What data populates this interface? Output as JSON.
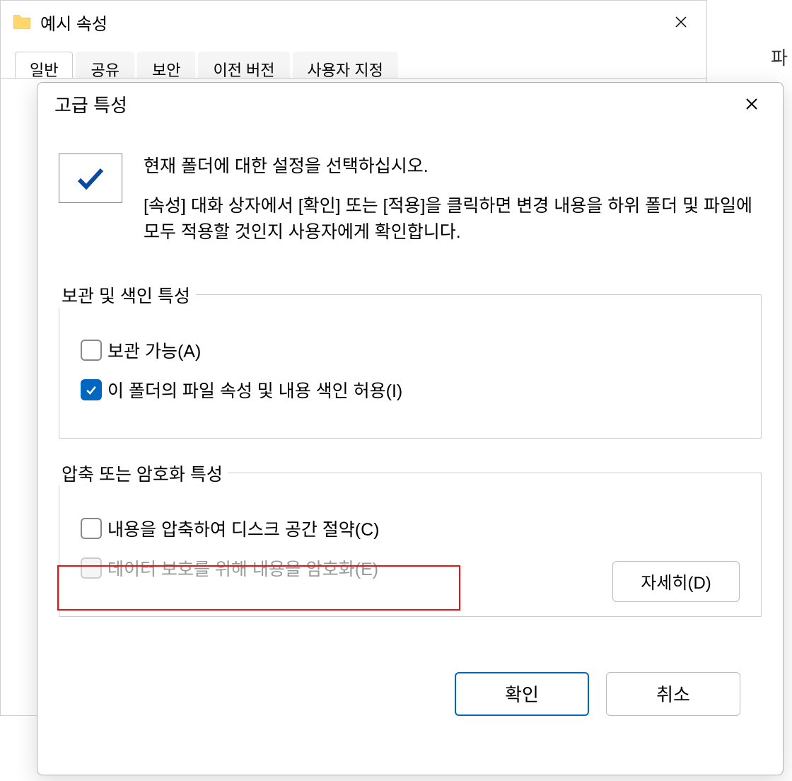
{
  "parent": {
    "title": "예시 속성",
    "tabs": [
      "일반",
      "공유",
      "보안",
      "이전 버전",
      "사용자 지정"
    ]
  },
  "rightEdge": "파",
  "advanced": {
    "title": "고급 특성",
    "intro1": "현재 폴더에 대한 설정을 선택하십시오.",
    "intro2": "[속성] 대화 상자에서 [확인] 또는 [적용]을 클릭하면 변경 내용을 하위 폴더 및 파일에 모두 적용할 것인지 사용자에게 확인합니다.",
    "group1_title": "보관 및 색인 특성",
    "option_archive": "보관 가능(A)",
    "option_index": "이 폴더의 파일 속성 및 내용 색인 허용(I)",
    "group2_title": "압축 또는 암호화 특성",
    "option_compress": "내용을 압축하여 디스크 공간 절약(C)",
    "option_encrypt": "데이터 보호를 위해 내용을 암호화(E)",
    "details_btn": "자세히(D)",
    "ok_btn": "확인",
    "cancel_btn": "취소"
  }
}
